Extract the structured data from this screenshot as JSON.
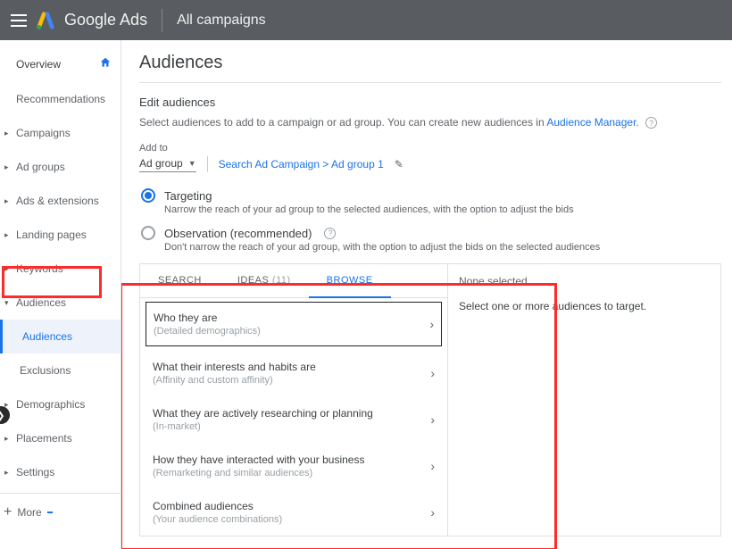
{
  "header": {
    "brand": "Google Ads",
    "campaign_scope": "All campaigns"
  },
  "sidebar": {
    "overview": "Overview",
    "items": [
      "Recommendations",
      "Campaigns",
      "Ad groups",
      "Ads & extensions",
      "Landing pages",
      "Keywords",
      "Audiences",
      "Demographics",
      "Placements",
      "Settings"
    ],
    "audiences_sub": {
      "audiences": "Audiences",
      "exclusions": "Exclusions"
    },
    "more": "More"
  },
  "content": {
    "title": "Audiences",
    "edit_title": "Edit audiences",
    "desc_pre": "Select audiences to add to a campaign or ad group. You can create new audiences in ",
    "desc_link": "Audience Manager",
    "addto_label": "Add to",
    "addto_value": "Ad group",
    "crumb": "Search Ad Campaign > Ad group 1",
    "radios": {
      "targeting": {
        "title": "Targeting",
        "desc": "Narrow the reach of your ad group to the selected audiences, with the option to adjust the bids"
      },
      "observation": {
        "title": "Observation (recommended)",
        "desc": "Don't narrow the reach of your ad group, with the option to adjust the bids on the selected audiences"
      }
    },
    "tabs": {
      "search": "SEARCH",
      "ideas": "IDEAS",
      "ideas_count": "(11)",
      "browse": "BROWSE"
    },
    "list": [
      {
        "t1": "Who they are",
        "t2": "(Detailed demographics)"
      },
      {
        "t1": "What their interests and habits are",
        "t2": "(Affinity and custom affinity)"
      },
      {
        "t1": "What they are actively researching or planning",
        "t2": "(In-market)"
      },
      {
        "t1": "How they have interacted with your business",
        "t2": "(Remarketing and similar audiences)"
      },
      {
        "t1": "Combined audiences",
        "t2": "(Your audience combinations)"
      }
    ],
    "right": {
      "none": "None selected",
      "hint": "Select one or more audiences to target."
    }
  }
}
